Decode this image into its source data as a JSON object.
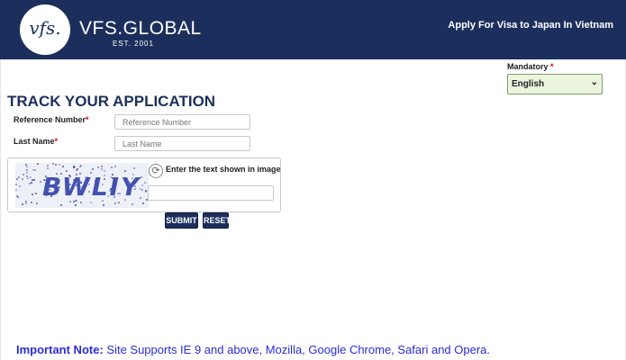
{
  "header": {
    "logo_text": "vfs.",
    "brand": "VFS.GLOBAL",
    "brand_sub": "EST. 2001",
    "apply_text": "Apply For Visa to Japan  In Vietnam"
  },
  "language": {
    "mandatory_label": "Mandatory",
    "required_mark": "*",
    "selected": "English",
    "arrow": "⌄"
  },
  "form": {
    "title": "TRACK YOUR APPLICATION",
    "reference_label": "Reference Number",
    "reference_placeholder": "Reference Number",
    "last_name_label": "Last Name",
    "last_name_placeholder": "Last Name",
    "required_mark": "*"
  },
  "captcha": {
    "image_text": "BWLIY",
    "refresh_icon": "⟳",
    "label": "Enter the text shown in image"
  },
  "buttons": {
    "submit": "SUBMIT",
    "reset": "RESET"
  },
  "note": {
    "heading": "Important Note:",
    "text": " Site Supports IE 9 and above, Mozilla, Google Chrome, Safari and Opera."
  },
  "colors": {
    "header_bg": "#1c2f5c",
    "title": "#1c2f5c",
    "note": "#2b2bd6",
    "required": "#d00000",
    "select_bg": "#eaf4df"
  }
}
